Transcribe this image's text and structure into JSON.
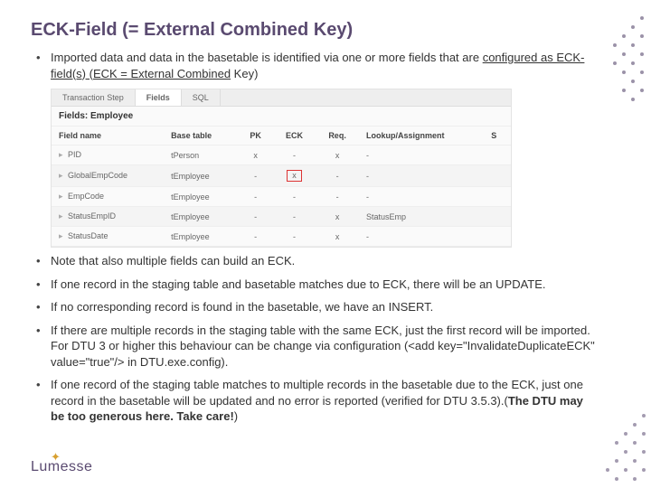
{
  "title": "ECK-Field (= External Combined Key)",
  "bullets": [
    "Imported data and data in the basetable is identified via one or more fields that are <u>configured as ECK-field(s) (ECK = External Combined</u> Key)",
    "Note that also multiple fields can build an ECK.",
    "If one record in the staging table and basetable matches due to ECK, there will be an UPDATE.",
    "If no corresponding record is found in the basetable, we have an INSERT.",
    "If there are multiple records in the staging table with the same ECK, just the first record will be imported. For DTU 3 or higher this behaviour can be change via configuration (&lt;add key=\"InvalidateDuplicateECK\" value=\"true\"/&gt; in DTU.exe.config).",
    "If one record of the staging table matches to multiple records in the basetable due to the ECK, just one record in the basetable will be updated and no error is reported (verified for DTU 3.5.3).(<strong>The DTU may be too generous here. Take care!</strong>)"
  ],
  "screenshot": {
    "tabs": [
      "Transaction Step",
      "Fields",
      "SQL"
    ],
    "activeTab": 1,
    "heading": "Fields: Employee",
    "columns": [
      "Field name",
      "Base table",
      "PK",
      "ECK",
      "Req.",
      "Lookup/Assignment",
      "S"
    ],
    "rows": [
      {
        "field": "PID",
        "base": "tPerson",
        "pk": "x",
        "eck": "-",
        "req": "x",
        "lookup": "-"
      },
      {
        "field": "GlobalEmpCode",
        "base": "tEmployee",
        "pk": "-",
        "eck": "x",
        "req": "-",
        "lookup": "-",
        "hl": true
      },
      {
        "field": "EmpCode",
        "base": "tEmployee",
        "pk": "-",
        "eck": "-",
        "req": "-",
        "lookup": "-"
      },
      {
        "field": "StatusEmpID",
        "base": "tEmployee",
        "pk": "-",
        "eck": "-",
        "req": "x",
        "lookup": "StatusEmp"
      },
      {
        "field": "StatusDate",
        "base": "tEmployee",
        "pk": "-",
        "eck": "-",
        "req": "x",
        "lookup": "-"
      }
    ]
  },
  "logo": "Lumesse"
}
